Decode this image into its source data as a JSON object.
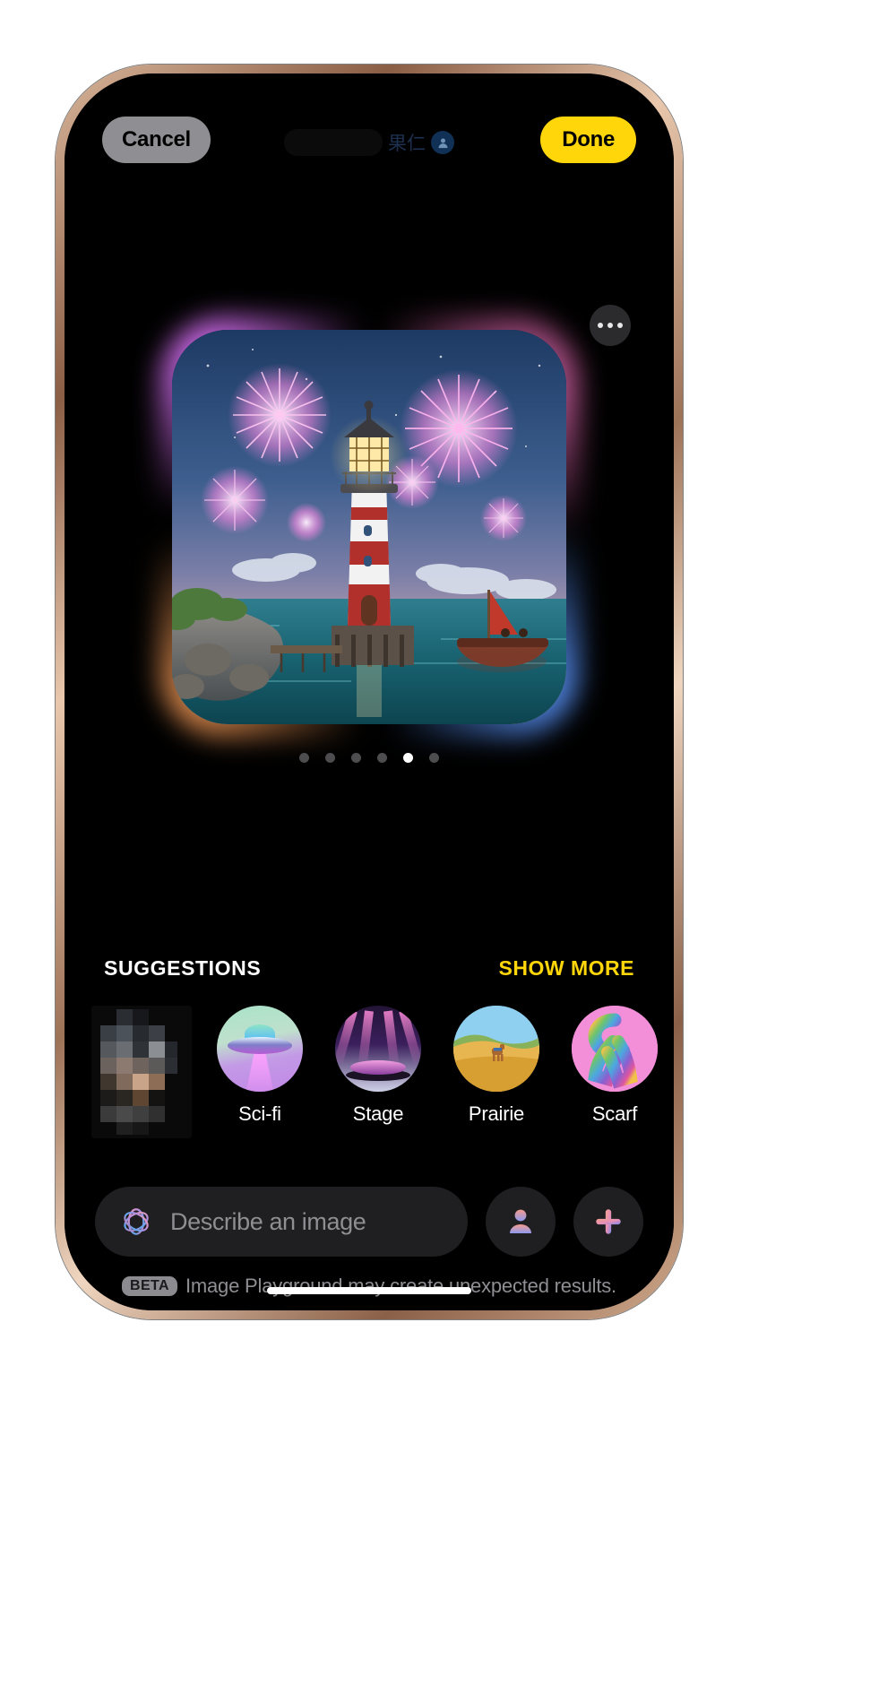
{
  "app": {
    "name": "Image Playground"
  },
  "topbar": {
    "cancel_label": "Cancel",
    "done_label": "Done",
    "watermark_text": "果仁",
    "watermark_icon": "person-badge-icon"
  },
  "canvas": {
    "more_button_icon": "ellipsis-icon",
    "image_alt": "Lighthouse on rocky shore with pink fireworks bursting in twilight sky and a small red sailboat",
    "page_dots": {
      "count": 6,
      "active_index": 4
    }
  },
  "suggestions": {
    "title": "SUGGESTIONS",
    "show_more_label": "SHOW MORE",
    "items": [
      {
        "label": "",
        "icon": "censored-thumbnail",
        "censored": true
      },
      {
        "label": "Sci-fi",
        "icon": "ufo-icon",
        "censored": false
      },
      {
        "label": "Stage",
        "icon": "stage-icon",
        "censored": false
      },
      {
        "label": "Prairie",
        "icon": "prairie-icon",
        "censored": false
      },
      {
        "label": "Scarf",
        "icon": "scarf-icon",
        "censored": false
      }
    ]
  },
  "composer": {
    "placeholder": "Describe an image",
    "value": "",
    "ai_icon": "apple-intelligence-icon",
    "person_button_icon": "person-icon",
    "add_button_icon": "plus-icon"
  },
  "footer": {
    "beta_badge": "BETA",
    "disclaimer": "Image Playground may create unexpected results."
  },
  "colors": {
    "accent_yellow": "#ffd60a",
    "cancel_gray": "#8e8e93",
    "surface": "#1f1f21",
    "background": "#000000",
    "muted_text": "#8e8e93"
  }
}
